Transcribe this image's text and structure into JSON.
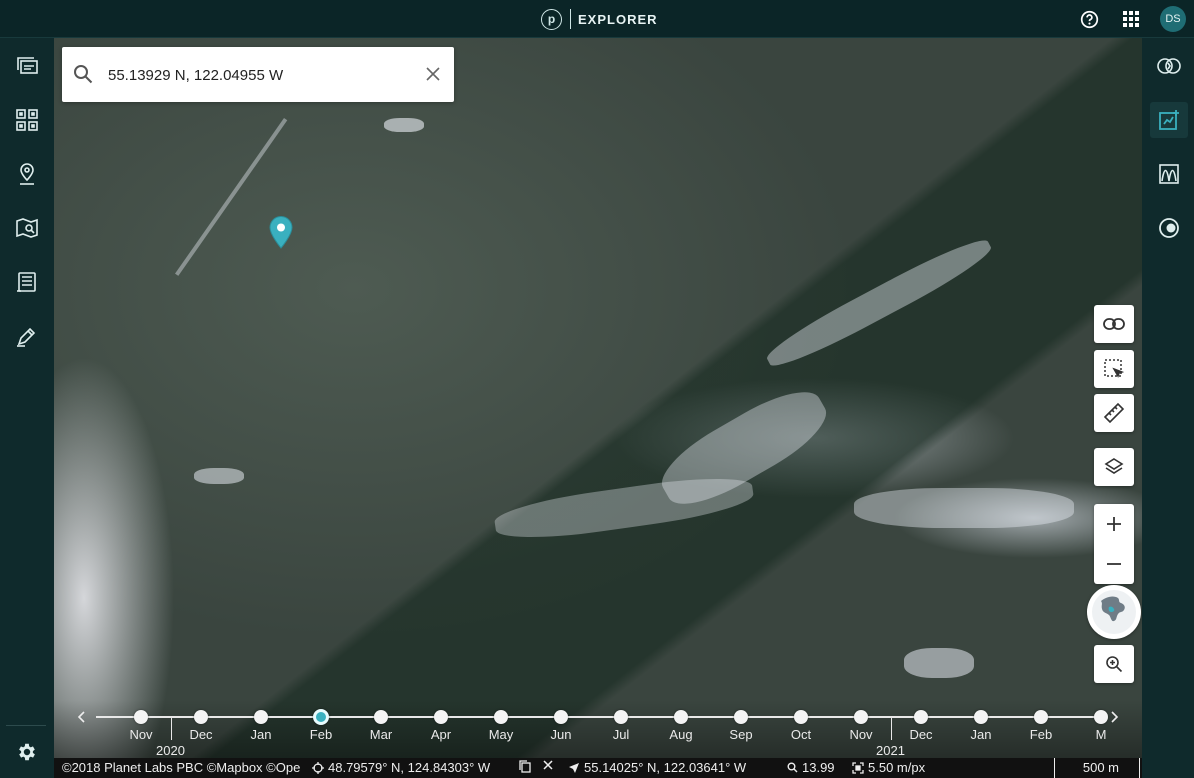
{
  "header": {
    "logo_letter": "p",
    "app_name": "EXPLORER",
    "user_initials": "DS"
  },
  "search": {
    "value": "55.13929 N, 122.04955 W"
  },
  "left_rail": [
    "layers-icon",
    "mosaic-grid-icon",
    "places-icon",
    "map-search-icon",
    "orders-icon",
    "draw-icon",
    "settings-icon"
  ],
  "right_rail": [
    "compare-icon",
    "analysis-icon",
    "graph-icon",
    "dark-mode-icon"
  ],
  "map_tools": [
    "link-icon",
    "select-area-icon",
    "ruler-icon",
    "layers-stack-icon",
    "zoom-in-icon",
    "zoom-out-icon",
    "globe-icon",
    "zoom-to-fit-icon"
  ],
  "timeline": {
    "months": [
      "Nov",
      "Dec",
      "Jan",
      "Feb",
      "Mar",
      "Apr",
      "May",
      "Jun",
      "Jul",
      "Aug",
      "Sep",
      "Oct",
      "Nov",
      "Dec",
      "Jan",
      "Feb",
      "M"
    ],
    "selected_month_index": 3,
    "years": [
      "2020",
      "2021"
    ]
  },
  "status": {
    "attribution": "©2018 Planet Labs PBC ©Mapbox ©Ope",
    "pin_coords": "48.79579° N, 124.84303° W",
    "cursor_coords": "55.14025° N, 122.03641° W",
    "zoom": "13.99",
    "resolution": "5.50 m/px",
    "scale": "500 m"
  },
  "colors": {
    "accent": "#3ab0bf",
    "topbar": "#0b2527",
    "rail": "#0f2a2c"
  }
}
